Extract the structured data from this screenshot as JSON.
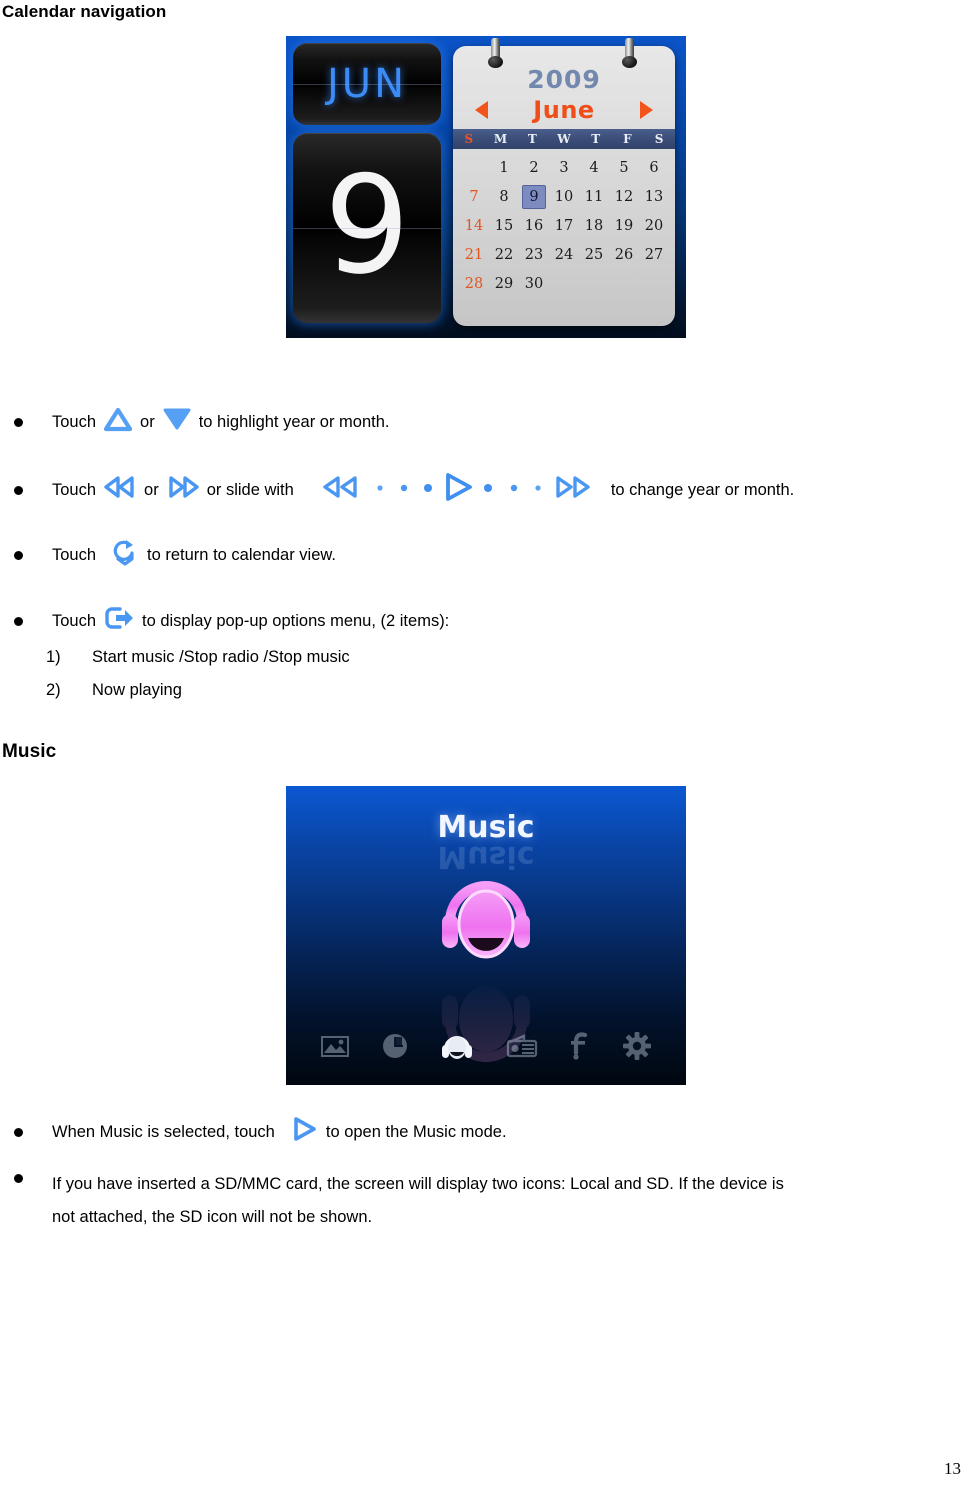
{
  "document": {
    "page_number": "13"
  },
  "sections": {
    "calendar": {
      "heading": "Calendar navigation",
      "screenshot": {
        "flip_month": "JUN",
        "flip_day": "9",
        "year": "2009",
        "month": "June",
        "prev_arrow_icon": "triangle-left-icon",
        "next_arrow_icon": "triangle-right-icon",
        "weekday_headers": [
          "S",
          "M",
          "T",
          "W",
          "T",
          "F",
          "S"
        ],
        "weeks": [
          [
            "",
            "1",
            "2",
            "3",
            "4",
            "5",
            "6"
          ],
          [
            "7",
            "8",
            "9",
            "10",
            "11",
            "12",
            "13"
          ],
          [
            "14",
            "15",
            "16",
            "17",
            "18",
            "19",
            "20"
          ],
          [
            "21",
            "22",
            "23",
            "24",
            "25",
            "26",
            "27"
          ],
          [
            "28",
            "29",
            "30",
            "",
            "",
            "",
            ""
          ]
        ],
        "selected_day": "9",
        "colors": {
          "year_text": "#7388ae",
          "month_text": "#ef4e18",
          "arrow": "#f2541b",
          "sunday_text": "#e2551f",
          "selected_day_bg": "#7d8cc0",
          "weekhead_bg": "#3b4e78",
          "flip_month_text": "#3b8cf7",
          "screen_bg": "#0b54c8"
        }
      },
      "bullets": [
        {
          "text_before": "Touch",
          "icon_1": "triangle-up-outline-icon",
          "text_middle": "or",
          "icon_2": "triangle-down-filled-icon",
          "text_after": "to highlight year or month."
        },
        {
          "text_before": "Touch",
          "icon_1": "rewind-double-left-icon",
          "text_middle": "or",
          "icon_2": "forward-double-right-icon",
          "text_middle_2": "or slide with",
          "icon_3": "slider-track-icon",
          "text_after": "to change year or month."
        },
        {
          "text_before": "Touch",
          "icon_1": "return-loop-arrow-icon",
          "text_after": "to return to calendar view."
        },
        {
          "text_before": "Touch",
          "icon_1": "popup-exit-arrow-icon",
          "text_after": "to display pop-up options menu, (2 items):"
        }
      ],
      "numbered_items": [
        {
          "marker": "1)",
          "text": "Start music /Stop radio /Stop music"
        },
        {
          "marker": "2)",
          "text": "Now playing"
        }
      ]
    },
    "music": {
      "heading": "Music",
      "screenshot": {
        "title": "Music",
        "hero_icon": "headphones-avatar-icon",
        "bottom_icons": [
          {
            "name": "photo-icon",
            "active": false
          },
          {
            "name": "clock-icon",
            "active": false
          },
          {
            "name": "headphones-icon",
            "active": true
          },
          {
            "name": "radio-icon",
            "active": false
          },
          {
            "name": "fm-f-icon",
            "active": false
          },
          {
            "name": "settings-gear-icon",
            "active": false
          }
        ],
        "colors": {
          "screen_bg_top": "#0b58d2",
          "screen_bg_bottom": "#01070f",
          "hero_pink": "#f07bf0",
          "title_text": "#f2f6ff"
        }
      },
      "bullets": [
        {
          "text_before": "When Music is selected, touch",
          "icon_1": "play-triangle-icon",
          "text_after": "to open the Music mode."
        },
        {
          "text_full_line1": "If you have inserted a SD/MMC card, the screen will display two icons: Local and SD. If the device is",
          "text_full_line2": "not attached, the SD icon will not be shown."
        }
      ]
    }
  }
}
